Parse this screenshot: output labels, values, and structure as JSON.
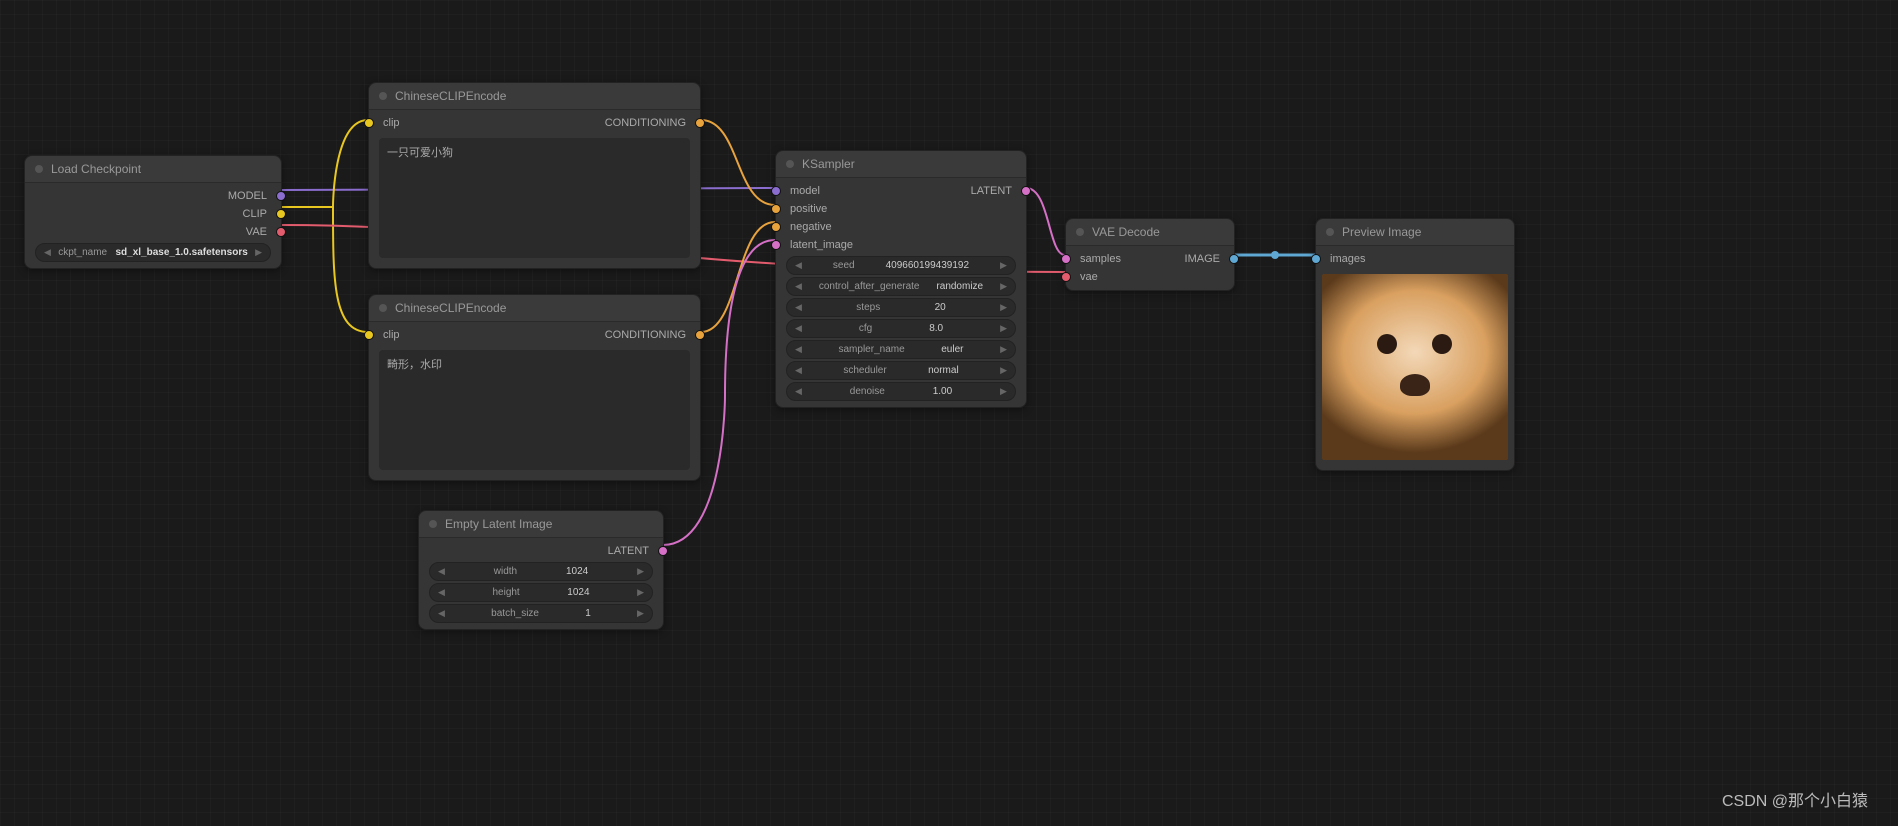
{
  "watermark": "CSDN @那个小白猿",
  "nodes": {
    "load": {
      "title": "Load Checkpoint",
      "out_model": "MODEL",
      "out_clip": "CLIP",
      "out_vae": "VAE",
      "ckpt_label": "ckpt_name",
      "ckpt_val": "sd_xl_base_1.0.safetensors"
    },
    "clip1": {
      "title": "ChineseCLIPEncode",
      "in_clip": "clip",
      "out": "CONDITIONING",
      "text": "一只可爱小狗"
    },
    "clip2": {
      "title": "ChineseCLIPEncode",
      "in_clip": "clip",
      "out": "CONDITIONING",
      "text": "畸形，水印"
    },
    "empty": {
      "title": "Empty Latent Image",
      "out": "LATENT",
      "width_l": "width",
      "width_v": "1024",
      "height_l": "height",
      "height_v": "1024",
      "batch_l": "batch_size",
      "batch_v": "1"
    },
    "ksamp": {
      "title": "KSampler",
      "in_model": "model",
      "in_pos": "positive",
      "in_neg": "negative",
      "in_lat": "latent_image",
      "out": "LATENT",
      "seed_l": "seed",
      "seed_v": "409660199439192",
      "ctrl_l": "control_after_generate",
      "ctrl_v": "randomize",
      "steps_l": "steps",
      "steps_v": "20",
      "cfg_l": "cfg",
      "cfg_v": "8.0",
      "sampler_l": "sampler_name",
      "sampler_v": "euler",
      "sched_l": "scheduler",
      "sched_v": "normal",
      "den_l": "denoise",
      "den_v": "1.00"
    },
    "vae": {
      "title": "VAE Decode",
      "in_samples": "samples",
      "in_vae": "vae",
      "out": "IMAGE"
    },
    "prev": {
      "title": "Preview Image",
      "in": "images"
    }
  }
}
